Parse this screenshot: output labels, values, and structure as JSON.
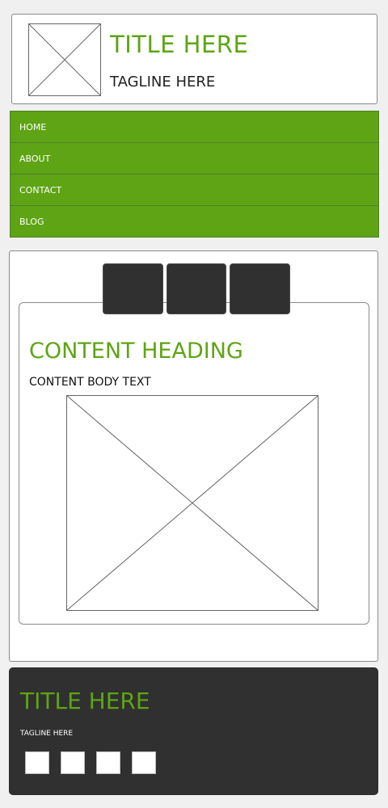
{
  "header": {
    "title": "TITLE HERE",
    "tagline": "TAGLINE HERE"
  },
  "nav": {
    "items": [
      {
        "label": "HOME"
      },
      {
        "label": "ABOUT"
      },
      {
        "label": "CONTACT"
      },
      {
        "label": "BLOG"
      }
    ]
  },
  "content": {
    "heading": "CONTENT HEADING",
    "body": "CONTENT BODY TEXT"
  },
  "footer": {
    "title": "TITLE HERE",
    "tagline": "TAGLINE HERE"
  },
  "colors": {
    "accent": "#5ea414",
    "dark": "#303030",
    "page_bg": "#f0f0f0"
  },
  "icons": {
    "logo": "placeholder-image-icon",
    "content_image": "placeholder-image-icon",
    "social_links": [
      "social-icon",
      "social-icon",
      "social-icon",
      "social-icon"
    ]
  }
}
